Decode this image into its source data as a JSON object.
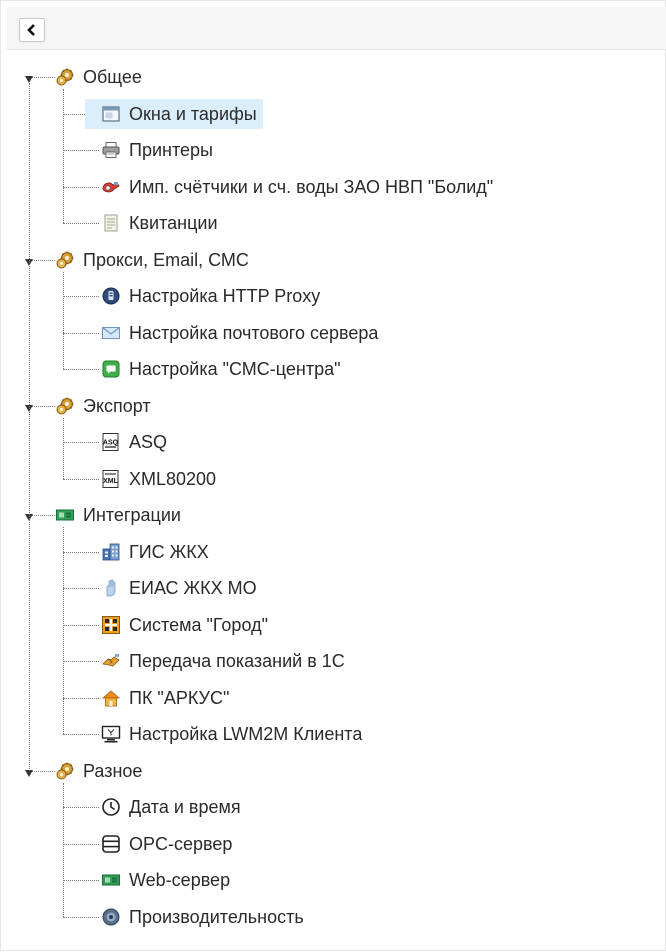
{
  "toolbar": {
    "back_label": "‹"
  },
  "groups": [
    {
      "label": "Общее",
      "icon": "gears-icon",
      "items": [
        {
          "label": "Окна и тарифы",
          "icon": "window-icon",
          "selected": true
        },
        {
          "label": "Принтеры",
          "icon": "printer-icon"
        },
        {
          "label": "Имп. счётчики и сч. воды ЗАО НВП \"Болид\"",
          "icon": "meter-icon"
        },
        {
          "label": "Квитанции",
          "icon": "receipt-icon"
        }
      ]
    },
    {
      "label": "Прокси, Email, СМС",
      "icon": "gears-icon",
      "items": [
        {
          "label": "Настройка HTTP Proxy",
          "icon": "proxy-icon"
        },
        {
          "label": "Настройка почтового сервера",
          "icon": "mail-icon"
        },
        {
          "label": "Настройка \"СМС-центра\"",
          "icon": "sms-icon"
        }
      ]
    },
    {
      "label": "Экспорт",
      "icon": "gears-icon",
      "items": [
        {
          "label": "ASQ",
          "icon": "asq-file-icon"
        },
        {
          "label": "XML80200",
          "icon": "xml-file-icon"
        }
      ]
    },
    {
      "label": "Интеграции",
      "icon": "integration-board-icon",
      "items": [
        {
          "label": "ГИС ЖКХ",
          "icon": "buildings-icon"
        },
        {
          "label": "ЕИАС ЖКХ МО",
          "icon": "hand-icon"
        },
        {
          "label": "Система \"Город\"",
          "icon": "city-grid-icon"
        },
        {
          "label": "Передача показаний в 1С",
          "icon": "handshake-icon"
        },
        {
          "label": "ПК \"АРКУС\"",
          "icon": "home-icon"
        },
        {
          "label": "Настройка LWM2M Клиента",
          "icon": "monitor-icon"
        }
      ]
    },
    {
      "label": "Разное",
      "icon": "gears-icon",
      "items": [
        {
          "label": "Дата и время",
          "icon": "clock-icon"
        },
        {
          "label": "OPC-сервер",
          "icon": "server-icon"
        },
        {
          "label": "Web-сервер",
          "icon": "web-board-icon"
        },
        {
          "label": "Производительность",
          "icon": "performance-icon"
        }
      ]
    }
  ],
  "colors": {
    "selected_bg": "#dbeefb",
    "line": "#777777"
  }
}
